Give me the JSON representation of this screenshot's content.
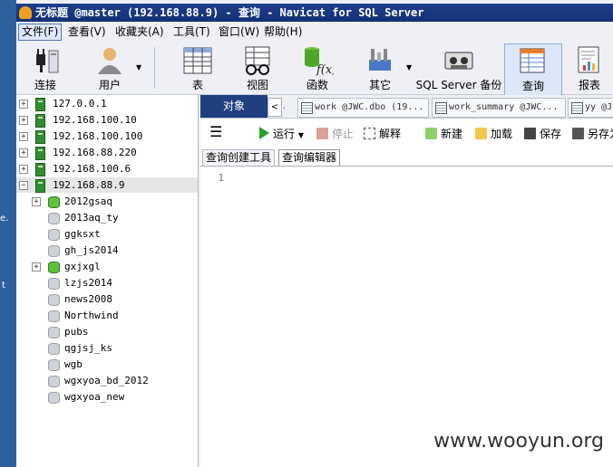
{
  "window": {
    "title": "无标题 @master (192.168.88.9) - 查询 - Navicat for SQL Server"
  },
  "desktop": {
    "fragment_1": "e.",
    "fragment_2": "t"
  },
  "menu": [
    "文件(F)",
    "查看(V)",
    "收藏夹(A)",
    "工具(T)",
    "窗口(W)",
    "帮助(H)"
  ],
  "toolbar": {
    "connect": "连接",
    "user": "用户",
    "table": "表",
    "view": "视图",
    "function": "函数",
    "other": "其它",
    "backup": "SQL Server 备份",
    "query": "查询",
    "report": "报表"
  },
  "tree": {
    "servers_top": [
      "127.0.0.1",
      "192.168.100.10",
      "192.168.100.100",
      "192.168.88.220",
      "192.168.100.6"
    ],
    "selected_server": "192.168.88.9",
    "databases": [
      "2012gsaq",
      "2013aq_ty",
      "ggksxt",
      "gh_js2014",
      "gxjxgl",
      "lzjs2014",
      "news2008",
      "Northwind",
      "pubs",
      "qgjsj_ks",
      "wgb",
      "wgxyoa_bd_2012",
      "wgxyoa_new"
    ]
  },
  "tabs": {
    "objects": "对象",
    "nav": "<",
    "docs": [
      "work @JWC.dbo (19...",
      "work_summary @JWC...",
      "yy @J"
    ],
    "fragment": "."
  },
  "query_toolbar": {
    "run": "运行",
    "stop": "停止",
    "explain": "解释",
    "new": "新建",
    "load": "加载",
    "save": "保存",
    "save_as": "另存为"
  },
  "subtabs": {
    "builder": "查询创建工具",
    "editor": "查询编辑器"
  },
  "editor": {
    "line": "1"
  },
  "watermark": "www.wooyun.org"
}
